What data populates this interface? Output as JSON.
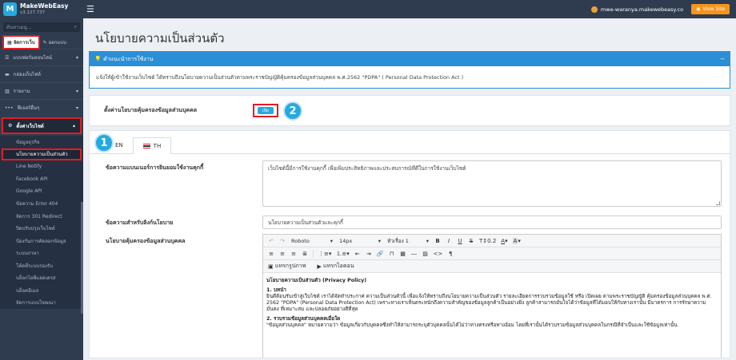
{
  "topbar": {
    "brand_name": "MakeWebEasy",
    "brand_version": "v3.127.737",
    "site_url": "mwe-waranya.makewebeasy.co",
    "view_site_label": "View Site"
  },
  "sidebar": {
    "search_placeholder": "ค้นหาเมนู...",
    "mode_manage": "จัดการเว็บ",
    "mode_design": "ออกแบบ",
    "items": [
      {
        "label": "แบบฟอร์มออนไลน์",
        "icon": "list-icon"
      },
      {
        "label": "กล่องเก็บไฟล์",
        "icon": "folder-icon"
      },
      {
        "label": "รายงาน",
        "icon": "chart-icon"
      },
      {
        "label": "ฟีเจอร์อื่นๆ",
        "icon": "more-icon"
      },
      {
        "label": "ตั้งค่าเว็บไซต์",
        "icon": "gear-icon"
      }
    ],
    "sub_items": [
      "ข้อมูลธุรกิจ",
      "นโยบายความเป็นส่วนตัว",
      "Line Notify",
      "Facebook API",
      "Google API",
      "ข้อความ Error 404",
      "จัดการ 301 Redirect",
      "ปิดปรับปรุงเว็บไซต์",
      "ป้องกันการคัดลอกข้อมูล",
      "ระบบภาษา",
      "โค้ดที่ระบบรองรับ",
      "บล็อกไอพีแอดเดรส",
      "บล็อคอีเมล",
      "จัดการแบบโฆษณา"
    ]
  },
  "main": {
    "page_title": "นโยบายความเป็นส่วนตัว",
    "info_title": "คำแนะนำการใช้งาน",
    "info_collapse": "−",
    "info_text": "แจ้งให้ผู้เข้าใช้งานเว็บไซต์ ได้ทราบถึงนโยบายความเป็นส่วนตัวตามพระราชบัญญัติคุ้มครองข้อมูลส่วนบุคคล พ.ศ.2562 \"PDPA\" ( Personal Data Protection Act )",
    "toggle_label": "ตั้งค่านโยบายคุ้มครองข้อมูลส่วนบุคคล",
    "toggle_state": "เปิด",
    "badge_1": "1",
    "badge_2": "2",
    "tabs": [
      "EN",
      "TH"
    ],
    "fields": {
      "cookie_label": "ข้อความแบนเนอร์การยินยอมใช้งานคุกกี้",
      "cookie_value": "เว็บไซต์นี้มีการใช้งานคุกกี้ เพื่อเพิ่มประสิทธิภาพและประสบการณ์ที่ดีในการใช้งานเว็บไซต์",
      "link_label": "ข้อความสำหรับลิงก์นโยบาย",
      "link_value": "นโยบายความเป็นส่วนตัวและคุกกี้",
      "policy_label": "นโยบายคุ้มครองข้อมูลส่วนบุคคล"
    },
    "editor": {
      "font": "Roboto",
      "size": "14px",
      "heading": "หัวเรื่อง 1",
      "line_height": "0.2",
      "insert_image": "แทรกรูปภาพ",
      "insert_video": "แทรกไอคอน"
    },
    "doc": {
      "title": "นโยบายความเป็นส่วนตัว (Privacy Policy)",
      "s1_title": "1. บทนำ",
      "s1_text": "ยินดีต้อนรับเข้าสู่เว็บไซต์ เราได้จัดทำประกาศ ความเป็นส่วนตัวนี้ เพื่อแจ้งให้ทราบถึงนโยบายความเป็นส่วนตัว รายละเอียดการรวบรวมข้อมูลใช้ หรือ เปิดเผย ตามพระราชบัญญัติ คุ้มครองข้อมูลส่วนบุคคล พ.ศ. 2562 \"PDPA\" (Personal Data Protection Act) เพราะทางเราเห็นตระหนักถึงความสำคัญของข้อมูลลูกค้าเป็นอย่างยิ่ง ลูกค้าสามารถมั่นใจได้ว่าข้อมูลที่ได้มอบให้กับทางเรานั้น มีมาตรการ การรักษาความมั่นคง ที่เหมาะสม และปลอดภัยอย่างดีที่สุด",
      "s2_title": "2. รวบรวมข้อมูลส่วนบุคคลเมื่อใด",
      "s2_text": "\"ข้อมูลส่วนบุคคล\" หมายความว่า ข้อมูลเกี่ยวกับบุคคลซึ่งทำให้สามารถระบุตัวบุคคลนั้นได้ไม่ว่าทางตรงหรือทางอ้อม โดยที่เรานั้นได้รวบรวมข้อมูลส่วนบุคคลในกรณีที่จำเป็นและใช้ข้อมูลเท่านั้น"
    }
  }
}
